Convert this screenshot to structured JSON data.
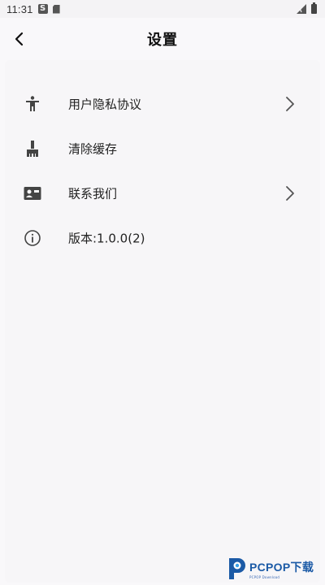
{
  "status_bar": {
    "time": "11:31",
    "s_icon": "S",
    "icons": [
      "sd-card-icon",
      "signal-icon",
      "battery-icon"
    ]
  },
  "app_bar": {
    "title": "设置",
    "back_icon": "chevron-left-icon"
  },
  "settings": {
    "items": [
      {
        "label": "用户隐私协议",
        "icon": "person-accessibility-icon",
        "has_chevron": true
      },
      {
        "label": "清除缓存",
        "icon": "broom-icon",
        "has_chevron": false
      },
      {
        "label": "联系我们",
        "icon": "contact-card-icon",
        "has_chevron": true
      },
      {
        "label": "版本:1.0.0(2)",
        "icon": "info-icon",
        "has_chevron": false
      }
    ]
  },
  "watermark": {
    "text": "PCPOP下载",
    "sub": "PCPOP Download"
  },
  "colors": {
    "background": "#f9f8fa",
    "icon": "#444444",
    "text": "#222222",
    "watermark": "#1b5aa6"
  }
}
